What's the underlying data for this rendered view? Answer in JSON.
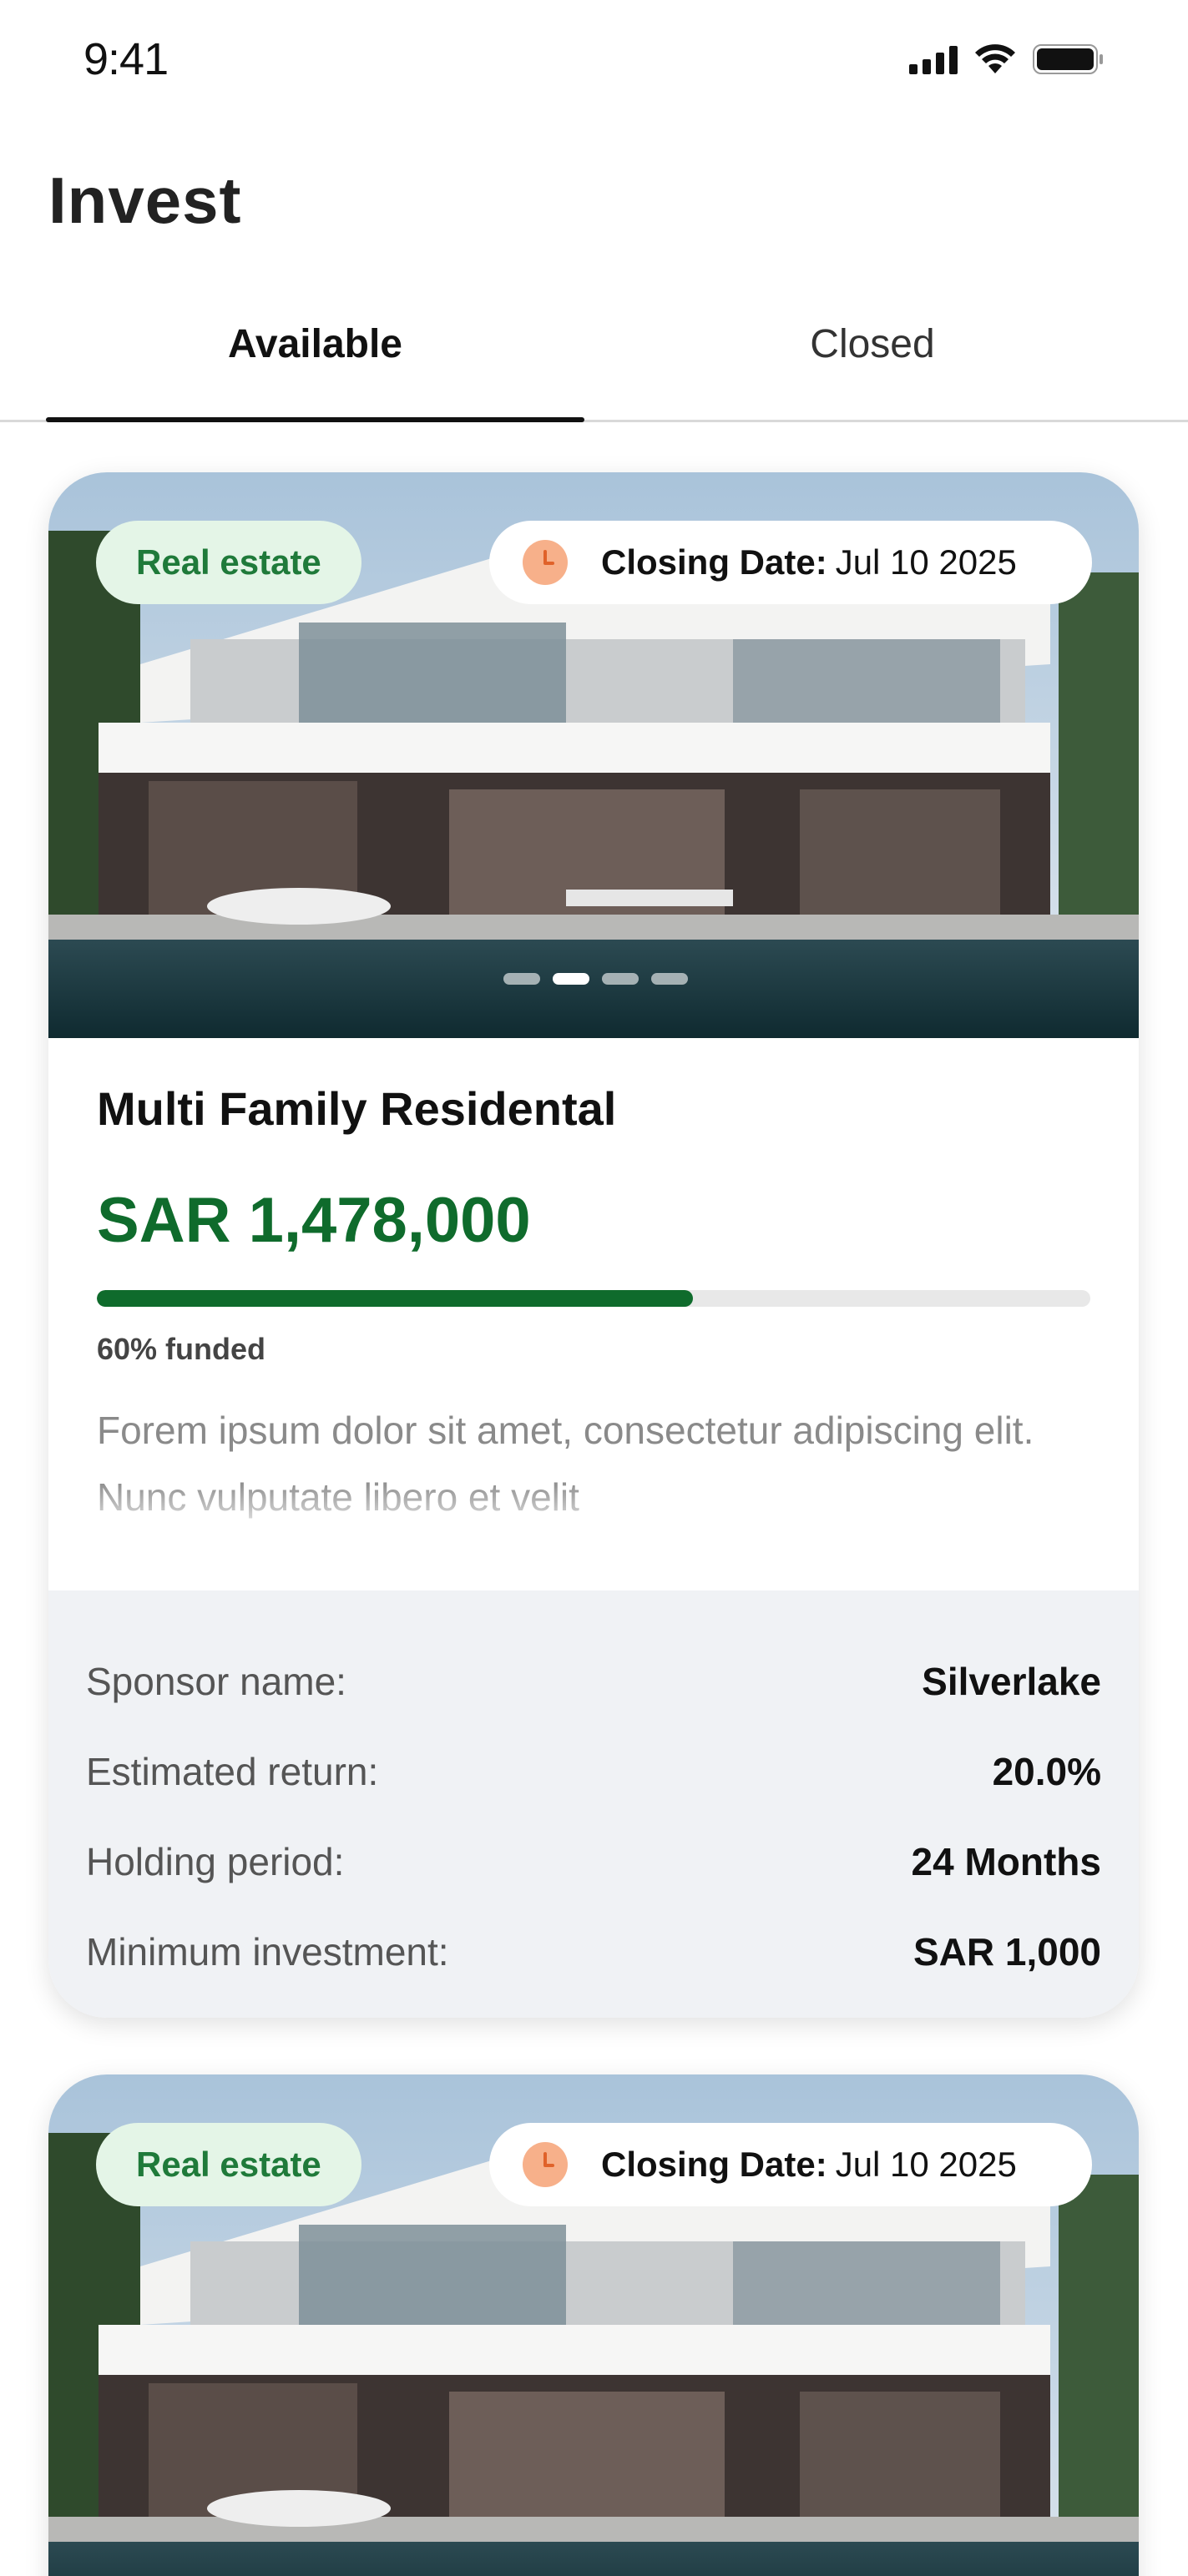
{
  "status_bar": {
    "time": "9:41"
  },
  "page": {
    "title": "Invest"
  },
  "tabs": [
    {
      "label": "Available",
      "active": true
    },
    {
      "label": "Closed",
      "active": false
    }
  ],
  "colors": {
    "accent_green": "#0f6b2c",
    "badge_green_bg": "#e4f5e7",
    "badge_green_text": "#1f7a3a",
    "clock_orange": "#f7b08a"
  },
  "cards": [
    {
      "category": "Real estate",
      "closing_label": "Closing Date:",
      "closing_date": "Jul 10 2025",
      "carousel_active_index": 1,
      "carousel_count": 4,
      "title": "Multi Family Residental",
      "amount": "SAR 1,478,000",
      "funded_percent": 60,
      "funded_text": "60% funded",
      "description": "Forem ipsum dolor sit amet, consectetur adipiscing elit. Nunc vulputate libero et velit",
      "details": [
        {
          "label": "Sponsor name:",
          "value": "Silverlake"
        },
        {
          "label": "Estimated return:",
          "value": "20.0%"
        },
        {
          "label": "Holding period:",
          "value": "24 Months"
        },
        {
          "label": "Minimum investment:",
          "value": "SAR 1,000"
        }
      ]
    },
    {
      "category": "Real estate",
      "closing_label": "Closing Date:",
      "closing_date": "Jul 10 2025"
    }
  ]
}
